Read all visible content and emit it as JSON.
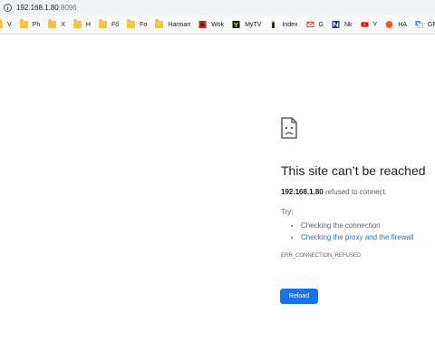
{
  "address_bar": {
    "host": "192.168.1.80",
    "port": ":8096",
    "icon": "info-icon"
  },
  "bookmarks": [
    {
      "label": "V",
      "icon": "folder-icon"
    },
    {
      "label": "Ph",
      "icon": "folder-icon"
    },
    {
      "label": "X",
      "icon": "folder-icon"
    },
    {
      "label": "H",
      "icon": "folder-icon"
    },
    {
      "label": "Fő",
      "icon": "folder-icon"
    },
    {
      "label": "Fo",
      "icon": "folder-icon"
    },
    {
      "label": "Harman",
      "icon": "folder-icon"
    },
    {
      "label": "Wok",
      "icon": "wok-favicon"
    },
    {
      "label": "MyTV",
      "icon": "mytv-favicon"
    },
    {
      "label": "Index",
      "icon": "index-favicon"
    },
    {
      "label": "G",
      "icon": "gmail-favicon"
    },
    {
      "label": "Nk",
      "icon": "nk-favicon"
    },
    {
      "label": "Y",
      "icon": "youtube-favicon"
    },
    {
      "label": "HA",
      "icon": "ha-favicon"
    },
    {
      "label": "GF",
      "icon": "translate-favicon"
    }
  ],
  "error": {
    "icon": "sad-page-icon",
    "title": "This site can’t be reached",
    "host": "192.168.1.80",
    "message": " refused to connect.",
    "try_label": "Try:",
    "suggestions": [
      {
        "text": "Checking the connection",
        "link": false
      },
      {
        "text": "Checking the proxy and the firewall",
        "link": true
      }
    ],
    "code": "ERR_CONNECTION_REFUSED",
    "reload_label": "Reload"
  },
  "colors": {
    "accent": "#1a73e8",
    "folder": "#f5c542",
    "text": "#202124",
    "secondary_text": "#5f6368"
  }
}
